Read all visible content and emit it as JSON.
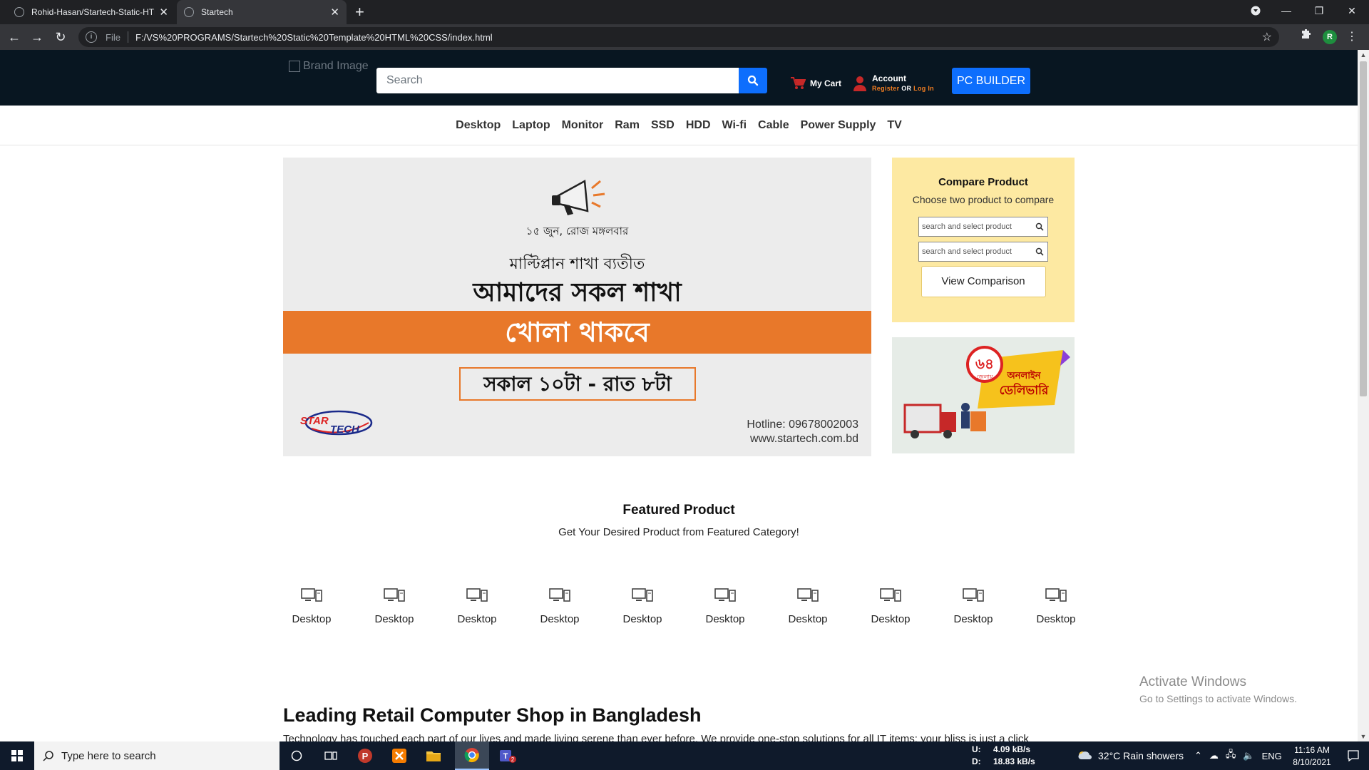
{
  "browser": {
    "tabs": [
      {
        "title": "Rohid-Hasan/Startech-Static-HTML",
        "active": false
      },
      {
        "title": "Startech",
        "active": true
      }
    ],
    "new_tab_label": "+",
    "address": {
      "scheme_label": "File",
      "url": "F:/VS%20PROGRAMS/Startech%20Static%20Template%20HTML%20CSS/index.html"
    },
    "profile_initial": "R"
  },
  "header": {
    "brand_alt": "Brand Image",
    "search_placeholder": "Search",
    "cart_label": "My Cart",
    "account_label": "Account",
    "account_register": "Register",
    "account_or": "OR",
    "account_login": "Log In",
    "pc_builder_label": "PC BUILDER"
  },
  "categories": [
    "Desktop",
    "Laptop",
    "Monitor",
    "Ram",
    "SSD",
    "HDD",
    "Wi-fi",
    "Cable",
    "Power Supply",
    "TV"
  ],
  "banner": {
    "date_line": "১৫ জুন, রোজ মঙ্গলবার",
    "line1": "মাল্টিপ্লান শাখা ব্যতীত",
    "line2": "আমাদের সকল শাখা",
    "strip": "খোলা থাকবে",
    "hours": "সকাল ১০টা - রাত ৮টা",
    "hotline": "Hotline: 09678002003",
    "website": "www.startech.com.bd",
    "logo_text_star": "STAR",
    "logo_text_tech": "TECH"
  },
  "compare": {
    "title": "Compare Product",
    "subtitle": "Choose two product to compare",
    "input1_placeholder": "search and select product",
    "input2_placeholder": "search and select product",
    "button_label": "View Comparison"
  },
  "delivery_ad": {
    "badge": "৬৪",
    "badge_sub": "জেলায়",
    "line1": "অনলাইন",
    "line2": "ডেলিভারি"
  },
  "featured": {
    "title": "Featured Product",
    "subtitle": "Get Your Desired Product from Featured Category!",
    "items": [
      {
        "label": "Desktop",
        "icon": "desktop-icon"
      },
      {
        "label": "Desktop",
        "icon": "desktop-icon"
      },
      {
        "label": "Desktop",
        "icon": "desktop-icon"
      },
      {
        "label": "Desktop",
        "icon": "desktop-icon"
      },
      {
        "label": "Desktop",
        "icon": "desktop-icon"
      },
      {
        "label": "Desktop",
        "icon": "desktop-icon"
      },
      {
        "label": "Desktop",
        "icon": "desktop-icon"
      },
      {
        "label": "Desktop",
        "icon": "desktop-icon"
      },
      {
        "label": "Desktop",
        "icon": "desktop-icon"
      },
      {
        "label": "Desktop",
        "icon": "desktop-icon"
      }
    ]
  },
  "leading": {
    "title": "Leading Retail Computer Shop in Bangladesh",
    "paragraph": "Technology has touched each part of our lives and made living serene than ever before. We provide one-stop solutions for all IT items; your bliss is just a click"
  },
  "watermark": {
    "line1": "Activate Windows",
    "line2": "Go to Settings to activate Windows."
  },
  "taskbar": {
    "search_placeholder": "Type here to search",
    "net_up_label": "U:",
    "net_up": "4.09 kB/s",
    "net_down_label": "D:",
    "net_down": "18.83 kB/s",
    "weather": "32°C  Rain showers",
    "lang": "ENG",
    "time": "11:16 AM",
    "date": "8/10/2021",
    "teams_badge": "2"
  },
  "colors": {
    "header_bg": "#081621",
    "accent_blue": "#0d6efd",
    "accent_orange": "#f27e22",
    "compare_bg": "#fde9a2"
  }
}
